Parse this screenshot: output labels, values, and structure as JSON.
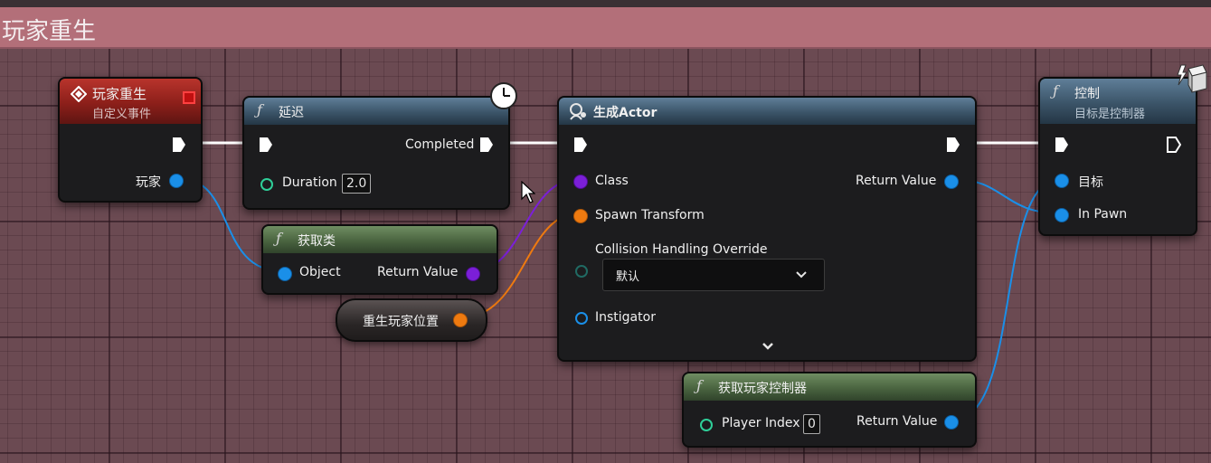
{
  "comment": {
    "title": "玩家重生"
  },
  "nodes": {
    "event": {
      "title": "玩家重生",
      "subtitle": "自定义事件",
      "pin_player": "玩家"
    },
    "delay": {
      "title": "延迟",
      "pin_completed": "Completed",
      "pin_duration": "Duration",
      "duration_value": "2.0"
    },
    "get_class": {
      "title": "获取类",
      "pin_object": "Object",
      "pin_return": "Return Value"
    },
    "respawn_var": {
      "label": "重生玩家位置"
    },
    "spawn_actor": {
      "title": "生成Actor",
      "pin_class": "Class",
      "pin_spawn_transform": "Spawn Transform",
      "pin_collision": "Collision Handling Override",
      "collision_value": "默认",
      "pin_instigator": "Instigator",
      "pin_return": "Return Value"
    },
    "get_player_controller": {
      "title": "获取玩家控制器",
      "pin_player_index": "Player Index",
      "player_index_value": "0",
      "pin_return": "Return Value"
    },
    "possess": {
      "title": "控制",
      "subtitle": "目标是控制器",
      "pin_target": "目标",
      "pin_in_pawn": "In Pawn"
    }
  },
  "colors": {
    "exec_wire": "#ffffff",
    "object_wire": "#1a8fe8",
    "class_wire": "#7b1fd8",
    "transform_wire": "#ee7a10"
  },
  "icons": [
    "event-diamond-icon",
    "function-icon",
    "clock-icon",
    "spawn-actor-icon",
    "chevron-down-icon",
    "mouse-cursor-icon",
    "authority-icon"
  ]
}
